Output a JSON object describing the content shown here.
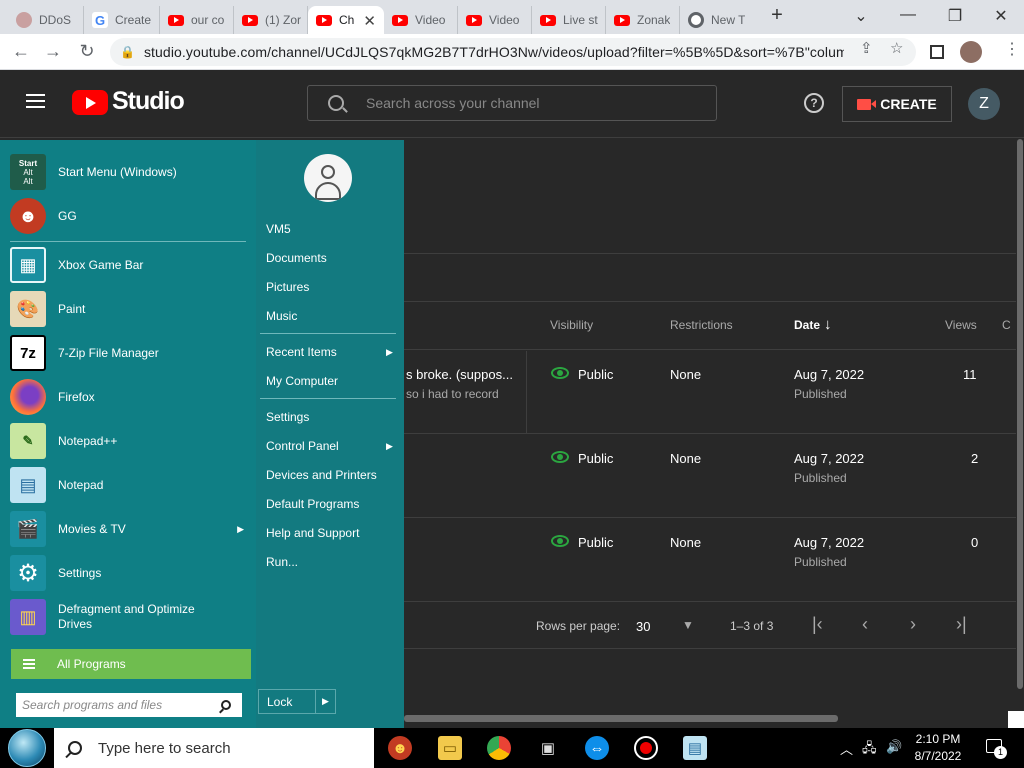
{
  "browser": {
    "tabs": [
      {
        "title": "DDoS",
        "favicon": "ddos-favicon"
      },
      {
        "title": "Create",
        "favicon": "google-favicon"
      },
      {
        "title": "our co",
        "favicon": "youtube-favicon"
      },
      {
        "title": "(1) Zor",
        "favicon": "youtube-favicon"
      },
      {
        "title": "Ch",
        "favicon": "youtube-favicon",
        "active": true
      },
      {
        "title": "Video",
        "favicon": "youtube-favicon"
      },
      {
        "title": "Video",
        "favicon": "youtube-favicon"
      },
      {
        "title": "Live st",
        "favicon": "youtube-favicon"
      },
      {
        "title": "Zonak",
        "favicon": "youtube-favicon"
      },
      {
        "title": "New T",
        "favicon": "chrome-favicon"
      }
    ],
    "new_tab": "+",
    "url": "studio.youtube.com/channel/UCdJLQS7qkMG2B7T7drHO3Nw/videos/upload?filter=%5B%5D&sort=%7B\"colum..."
  },
  "studio": {
    "logo_text": "Studio",
    "search_placeholder": "Search across your channel",
    "help_label": "?",
    "create_label": "CREATE",
    "avatar_initial": "Z"
  },
  "table": {
    "headers": {
      "visibility": "Visibility",
      "restrictions": "Restrictions",
      "date": "Date",
      "views": "Views",
      "cut": "C"
    },
    "sort_arrow": "↓",
    "rows": [
      {
        "title_fragment": "s broke. (suppos...",
        "desc_fragment": "so i had to record",
        "visibility": "Public",
        "restrictions": "None",
        "date": "Aug 7, 2022",
        "status": "Published",
        "views": "11"
      },
      {
        "visibility": "Public",
        "restrictions": "None",
        "date": "Aug 7, 2022",
        "status": "Published",
        "views": "2"
      },
      {
        "visibility": "Public",
        "restrictions": "None",
        "date": "Aug 7, 2022",
        "status": "Published",
        "views": "0"
      }
    ],
    "pagination": {
      "rows_per_page_label": "Rows per page:",
      "rows_per_page": "30",
      "range": "1–3 of 3"
    }
  },
  "start_menu": {
    "items": [
      {
        "label": "Start Menu (Windows)",
        "icon": "start-menu-icon"
      },
      {
        "label": "GG",
        "icon": "gg-smiley-icon"
      },
      {
        "label": "Xbox Game Bar",
        "icon": "xbox-game-bar-icon"
      },
      {
        "label": "Paint",
        "icon": "paint-palette-icon"
      },
      {
        "label": "7-Zip File Manager",
        "icon": "7zip-icon"
      },
      {
        "label": "Firefox",
        "icon": "firefox-icon"
      },
      {
        "label": "Notepad++",
        "icon": "notepad-plus-plus-icon"
      },
      {
        "label": "Notepad",
        "icon": "notepad-icon"
      },
      {
        "label": "Movies & TV",
        "icon": "movies-tv-icon",
        "submenu": true
      },
      {
        "label": "Settings",
        "icon": "settings-gear-icon"
      },
      {
        "label": "Defragment and Optimize Drives",
        "icon": "defragment-icon"
      }
    ],
    "start_icon_text": [
      "Start",
      "Alt",
      "Alt"
    ],
    "zip_icon_text": "7z",
    "all_programs": "All Programs",
    "search_placeholder": "Search programs and files",
    "right_links": [
      {
        "label": "VM5"
      },
      {
        "label": "Documents"
      },
      {
        "label": "Pictures"
      },
      {
        "label": "Music"
      },
      {
        "label": "Recent Items",
        "submenu": true
      },
      {
        "label": "My Computer"
      },
      {
        "label": "Settings"
      },
      {
        "label": "Control Panel",
        "submenu": true
      },
      {
        "label": "Devices and Printers"
      },
      {
        "label": "Default Programs"
      },
      {
        "label": "Help and Support"
      },
      {
        "label": "Run..."
      }
    ],
    "lock_label": "Lock"
  },
  "taskbar": {
    "search_placeholder": "Type here to search",
    "time": "2:10 PM",
    "date": "8/7/2022",
    "notification_count": "1"
  },
  "colors": {
    "start_menu_bg": "#0f7f85",
    "all_programs_bg": "#6fbd4f",
    "youtube_red": "#ff0000",
    "public_green": "#2ba640"
  }
}
